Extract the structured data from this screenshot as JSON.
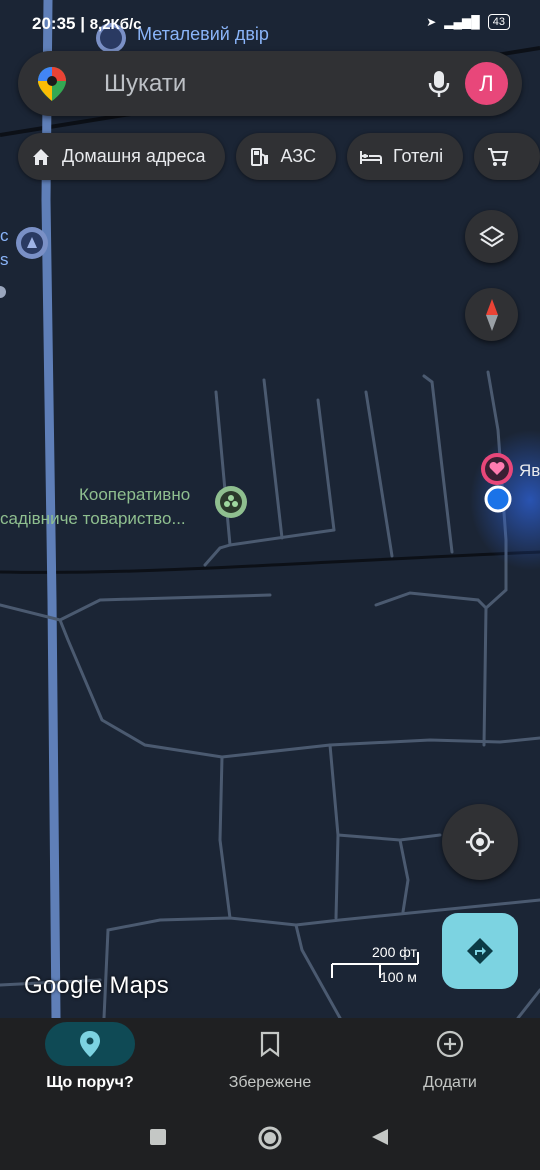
{
  "status": {
    "time": "20:35",
    "speed": "8,2Кб/с",
    "battery": "43"
  },
  "search": {
    "placeholder": "Шукати",
    "avatar_letter": "Л"
  },
  "chips": [
    {
      "label": "Домашня адреса",
      "icon": "home-icon"
    },
    {
      "label": "АЗС",
      "icon": "gas-station-icon"
    },
    {
      "label": "Готелі",
      "icon": "bed-icon"
    },
    {
      "label": "",
      "icon": "shopping-cart-icon"
    }
  ],
  "map": {
    "top_place": "Металевий двір",
    "left_place_line1": "с",
    "left_place_line2": "s",
    "coop_line1": "Кооперативно",
    "coop_line2": "садівниче товариство...",
    "right_place": "Яв",
    "scale_ft": "200 фт",
    "scale_m": "100 м",
    "logo": "Google Maps"
  },
  "bottom_nav": [
    {
      "label": "Що поруч?",
      "icon": "location-pin-icon",
      "active": true
    },
    {
      "label": "Збережене",
      "icon": "bookmark-icon",
      "active": false
    },
    {
      "label": "Додати",
      "icon": "add-circle-icon",
      "active": false
    }
  ],
  "colors": {
    "accent": "#7cd3e1",
    "avatar": "#e8477a",
    "map_bg": "#1b2535",
    "road": "#4b5a70"
  }
}
